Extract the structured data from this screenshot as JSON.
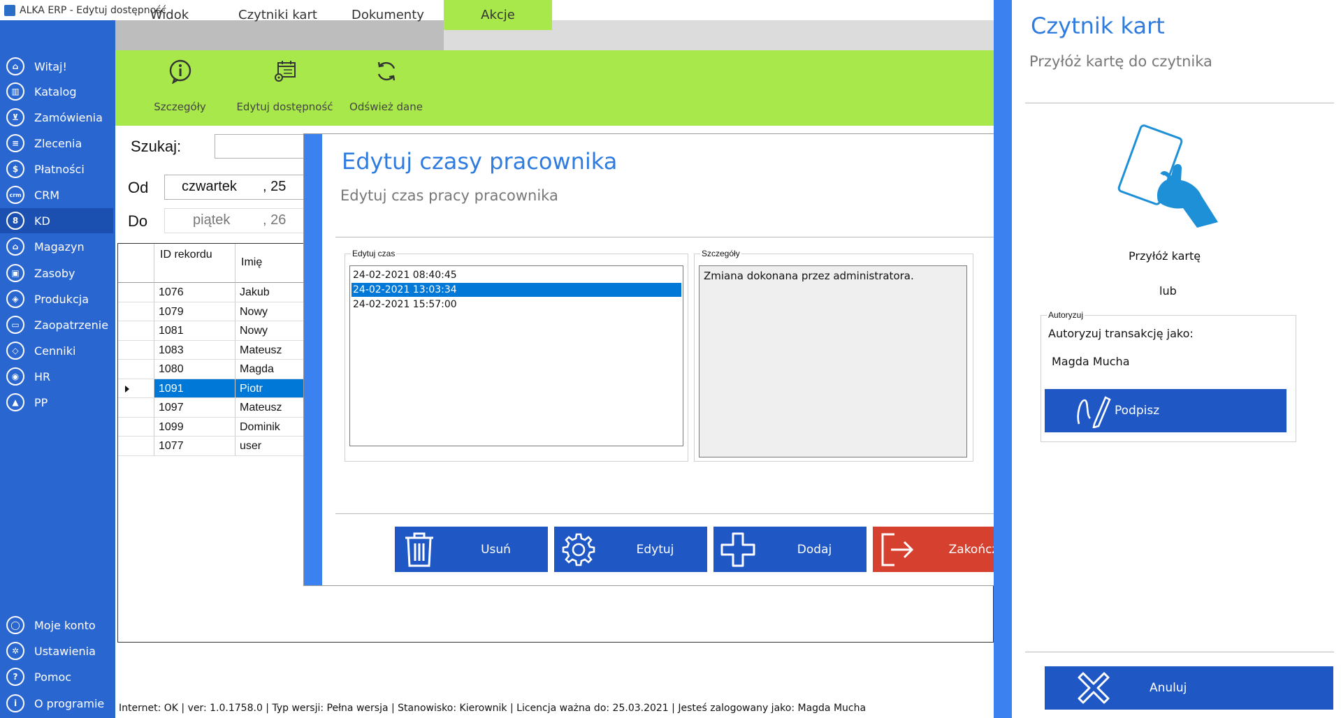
{
  "window": {
    "title": "ALKA ERP - Edytuj dostępność"
  },
  "sidebar": {
    "items": [
      {
        "label": "Witaj!",
        "icon": "home-icon",
        "glyph": "⌂"
      },
      {
        "label": "Katalog",
        "icon": "book-icon",
        "glyph": "▥"
      },
      {
        "label": "Zamówienia",
        "icon": "cart-icon",
        "glyph": "⊻"
      },
      {
        "label": "Zlecenia",
        "icon": "list-icon",
        "glyph": "≡"
      },
      {
        "label": "Płatności",
        "icon": "dollar-icon",
        "glyph": "$"
      },
      {
        "label": "CRM",
        "icon": "crm-icon",
        "glyph": "crm"
      },
      {
        "label": "KD",
        "icon": "person-icon",
        "glyph": "8"
      },
      {
        "label": "Magazyn",
        "icon": "warehouse-icon",
        "glyph": "⌂"
      },
      {
        "label": "Zasoby",
        "icon": "resources-icon",
        "glyph": "▣"
      },
      {
        "label": "Produkcja",
        "icon": "production-icon",
        "glyph": "◈"
      },
      {
        "label": "Zaopatrzenie",
        "icon": "truck-icon",
        "glyph": "▭"
      },
      {
        "label": "Cenniki",
        "icon": "tag-icon",
        "glyph": "◇"
      },
      {
        "label": "HR",
        "icon": "hr-icon",
        "glyph": "◉"
      },
      {
        "label": "PP",
        "icon": "pp-icon",
        "glyph": "▲"
      }
    ],
    "bottom": [
      {
        "label": "Moje konto",
        "icon": "account-icon",
        "glyph": "◯"
      },
      {
        "label": "Ustawienia",
        "icon": "settings-icon",
        "glyph": "✲"
      },
      {
        "label": "Pomoc",
        "icon": "help-icon",
        "glyph": "?"
      },
      {
        "label": "O programie",
        "icon": "info-icon",
        "glyph": "i"
      }
    ]
  },
  "tabs": [
    "Widok",
    "Czytniki kart",
    "Dokumenty",
    "Akcje"
  ],
  "ribbon": {
    "details": "Szczegóły",
    "edit_availability": "Edytuj dostępność",
    "refresh": "Odśwież dane"
  },
  "search": {
    "label": "Szukaj:",
    "from_label": "Od",
    "from_day": "czwartek",
    "from_date": ", 25",
    "to_label": "Do",
    "to_day": "piątek",
    "to_date": ", 26"
  },
  "grid": {
    "headers": {
      "id": "ID rekordu",
      "name": "Imię"
    },
    "rows": [
      {
        "id": "1076",
        "name": "Jakub"
      },
      {
        "id": "1079",
        "name": "Nowy"
      },
      {
        "id": "1081",
        "name": "Nowy"
      },
      {
        "id": "1083",
        "name": "Mateusz"
      },
      {
        "id": "1080",
        "name": "Magda"
      },
      {
        "id": "1091",
        "name": "Piotr"
      },
      {
        "id": "1097",
        "name": "Mateusz"
      },
      {
        "id": "1099",
        "name": "Dominik"
      },
      {
        "id": "1077",
        "name": "user"
      }
    ],
    "selected_index": 5
  },
  "status": "Internet: OK  |   ver: 1.0.1758.0  |   Typ wersji: Pełna wersja   |   Stanowisko: Kierownik   |   Licencja ważna do: 25.03.2021  |   Jesteś zalogowany jako: Magda Mucha",
  "modal": {
    "title": "Edytuj czasy pracownika",
    "subtitle": "Edytuj czas pracy pracownika",
    "edit_group": "Edytuj czas",
    "times": [
      "24-02-2021 08:40:45",
      "24-02-2021 13:03:34",
      "24-02-2021 15:57:00"
    ],
    "selected_time_index": 1,
    "details_group": "Szczegóły",
    "details_text": "Zmiana dokonana przez administratora.",
    "buttons": {
      "delete": "Usuń",
      "edit": "Edytuj",
      "add": "Dodaj",
      "finish": "Zakończ"
    }
  },
  "card_reader": {
    "title": "Czytnik kart",
    "subtitle": "Przyłóż kartę do czytnika",
    "prompt": "Przyłóż kartę",
    "or": "lub",
    "auth_group": "Autoryzuj",
    "auth_label": "Autoryzuj transakcję jako:",
    "user": "Magda Mucha",
    "sign_button": "Podpisz",
    "cancel_button": "Anuluj"
  },
  "colors": {
    "sidebar": "#2a66d0",
    "ribbon": "#a8e84a",
    "accent": "#3b82f0",
    "button_blue": "#1f57c4",
    "button_red": "#d6412f",
    "selection": "#0078d7"
  }
}
